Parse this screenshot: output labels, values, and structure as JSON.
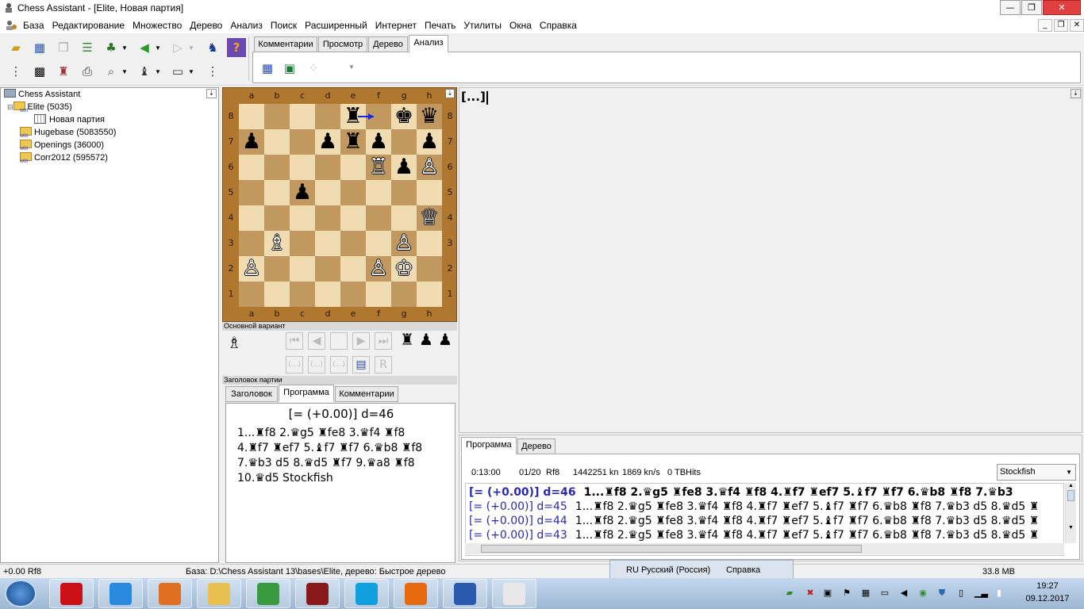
{
  "window": {
    "title": "Chess Assistant - [Elite, Новая партия]"
  },
  "menu": [
    "База",
    "Редактирование",
    "Множество",
    "Дерево",
    "Анализ",
    "Поиск",
    "Расширенный",
    "Интернет",
    "Печать",
    "Утилиты",
    "Окна",
    "Справка"
  ],
  "top_tabs": [
    "Комментарии",
    "Просмотр",
    "Дерево",
    "Анализ"
  ],
  "top_tab_active": "Анализ",
  "tree": {
    "root": "Chess Assistant",
    "items": [
      {
        "label": "Elite (5035)"
      },
      {
        "label": "Новая партия"
      },
      {
        "label": "Hugebase (5083550)"
      },
      {
        "label": "Openings (36000)"
      },
      {
        "label": "Corr2012 (595572)"
      }
    ],
    "win_tag": "win"
  },
  "board": {
    "files": [
      "a",
      "b",
      "c",
      "d",
      "e",
      "f",
      "g",
      "h"
    ],
    "ranks": [
      "8",
      "7",
      "6",
      "5",
      "4",
      "3",
      "2",
      "1"
    ],
    "pieces": [
      {
        "sq": "e8",
        "glyph": "♜",
        "color": "black"
      },
      {
        "sq": "g8",
        "glyph": "♚",
        "color": "black"
      },
      {
        "sq": "h8",
        "glyph": "♛",
        "color": "black"
      },
      {
        "sq": "a7",
        "glyph": "♟",
        "color": "black"
      },
      {
        "sq": "d7",
        "glyph": "♟",
        "color": "black"
      },
      {
        "sq": "e7",
        "glyph": "♜",
        "color": "black"
      },
      {
        "sq": "f7",
        "glyph": "♟",
        "color": "black"
      },
      {
        "sq": "h7",
        "glyph": "♟",
        "color": "black"
      },
      {
        "sq": "f6",
        "glyph": "♖",
        "color": "white"
      },
      {
        "sq": "g6",
        "glyph": "♟",
        "color": "black"
      },
      {
        "sq": "h6",
        "glyph": "♙",
        "color": "white"
      },
      {
        "sq": "c5",
        "glyph": "♟",
        "color": "black"
      },
      {
        "sq": "h4",
        "glyph": "♕",
        "color": "white"
      },
      {
        "sq": "b3",
        "glyph": "♗",
        "color": "white"
      },
      {
        "sq": "g3",
        "glyph": "♙",
        "color": "white"
      },
      {
        "sq": "a2",
        "glyph": "♙",
        "color": "white"
      },
      {
        "sq": "f2",
        "glyph": "♙",
        "color": "white"
      },
      {
        "sq": "g2",
        "glyph": "♔",
        "color": "white"
      }
    ],
    "arrow": {
      "from": "e8",
      "to": "f8",
      "color": "#1a2ad8"
    },
    "light_color": "#f0dcb0",
    "dark_color": "#c09860"
  },
  "mainline": {
    "title": "Основной вариант"
  },
  "nav": {
    "dots": "(...)"
  },
  "header_panel": {
    "title": "Заголовок партии",
    "tabs": [
      "Заголовок",
      "Программа",
      "Комментарии"
    ],
    "active": "Программа"
  },
  "notation": {
    "eval": "[= (+0.00)] d=46",
    "lines": [
      "1...♜f8 2.♛g5 ♜fe8 3.♛f4 ♜f8",
      "4.♜f7 ♜ef7 5.♝f7 ♜f7 6.♛b8 ♜f8",
      "7.♛b3 d5 8.♛d5 ♜f7 9.♛a8 ♜f8",
      "10.♛d5 Stockfish"
    ]
  },
  "annotation": {
    "text": "[...]"
  },
  "engine": {
    "tabs": [
      "Программа",
      "Дерево"
    ],
    "active": "Программа",
    "time": "0:13:00",
    "move_num": "01/20",
    "current_move": "Rf8",
    "nodes": "1442251 kn",
    "speed": "1869 kn/s",
    "tbhits": "0 TBHits",
    "engine_name": "Stockfish",
    "lines": [
      {
        "eval": "[= (+0.00)] d=46",
        "pv": "1...♜f8 2.♛g5 ♜fe8 3.♛f4 ♜f8 4.♜f7 ♜ef7 5.♝f7 ♜f7 6.♛b8 ♜f8 7.♛b3",
        "bold": true
      },
      {
        "eval": "[= (+0.00)] d=45",
        "pv": "1...♜f8 2.♛g5 ♜fe8 3.♛f4 ♜f8 4.♜f7 ♜ef7 5.♝f7 ♜f7 6.♛b8 ♜f8 7.♛b3 d5 8.♛d5 ♜",
        "bold": false
      },
      {
        "eval": "[= (+0.00)] d=44",
        "pv": "1...♜f8 2.♛g5 ♜fe8 3.♛f4 ♜f8 4.♜f7 ♜ef7 5.♝f7 ♜f7 6.♛b8 ♜f8 7.♛b3 d5 8.♛d5 ♜",
        "bold": false
      },
      {
        "eval": "[= (+0.00)] d=43",
        "pv": "1...♜f8 2.♛g5 ♜fe8 3.♛f4 ♜f8 4.♜f7 ♜ef7 5.♝f7 ♜f7 6.♛b8 ♜f8 7.♛b3 d5 8.♛d5 ♜",
        "bold": false
      }
    ]
  },
  "status": {
    "eval": "+0.00 Rf8",
    "base": "База: D:\\Chess Assistant 13\\bases\\Elite, дерево: Быстрое дерево",
    "lang": "RU Русский (Россия)",
    "help": "Справка",
    "memory": "33.8 MB"
  },
  "taskbar": {
    "time": "19:27",
    "date": "09.12.2017",
    "apps": [
      {
        "name": "opera",
        "color": "#cc1018"
      },
      {
        "name": "internet-explorer",
        "color": "#2a8ae0"
      },
      {
        "name": "media-player",
        "color": "#e07020"
      },
      {
        "name": "file-explorer",
        "color": "#e8c050"
      },
      {
        "name": "chrome",
        "color": "#3a9a40"
      },
      {
        "name": "chess-app",
        "color": "#8a1a1a"
      },
      {
        "name": "skype",
        "color": "#10a0e0"
      },
      {
        "name": "firefox",
        "color": "#e86a10"
      },
      {
        "name": "word",
        "color": "#2a5ab0"
      },
      {
        "name": "chess-assistant",
        "color": "#e8e8e8"
      }
    ]
  }
}
